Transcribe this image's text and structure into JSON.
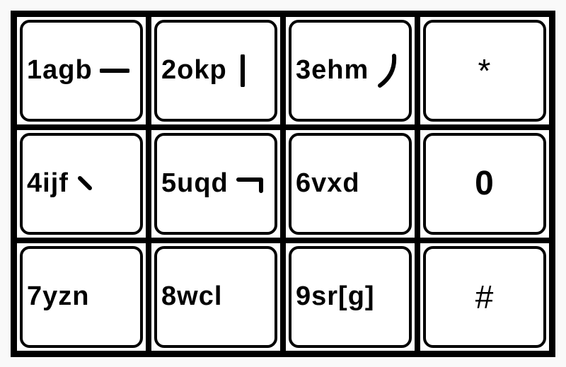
{
  "keypad": {
    "keys": [
      {
        "label": "1agb",
        "stroke": "heng",
        "centered": false
      },
      {
        "label": "2okp",
        "stroke": "shu",
        "centered": false
      },
      {
        "label": "3ehm",
        "stroke": "pie",
        "centered": false
      },
      {
        "label": "*",
        "stroke": null,
        "centered": true
      },
      {
        "label": "4ijf",
        "stroke": "dian",
        "centered": false
      },
      {
        "label": "5uqd",
        "stroke": "zhe",
        "centered": false
      },
      {
        "label": "6vxd",
        "stroke": null,
        "centered": false
      },
      {
        "label": "0",
        "stroke": null,
        "centered": true
      },
      {
        "label": "7yzn",
        "stroke": null,
        "centered": false
      },
      {
        "label": "8wcl",
        "stroke": null,
        "centered": false
      },
      {
        "label": "9sr[g]",
        "stroke": null,
        "centered": false
      },
      {
        "label": "#",
        "stroke": null,
        "centered": true
      }
    ]
  }
}
